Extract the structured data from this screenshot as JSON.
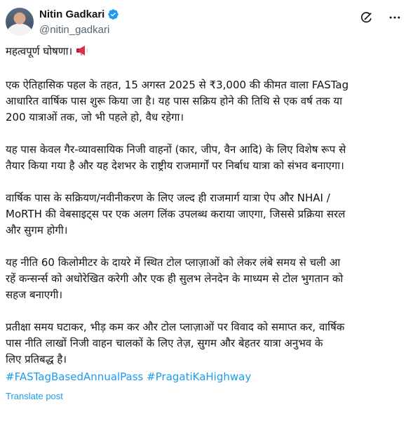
{
  "author": {
    "name": "Nitin Gadkari",
    "handle": "@nitin_gadkari",
    "verified": true,
    "verified_color": "#1d9bf0"
  },
  "header_icons": [
    "grok-icon",
    "more-options-icon"
  ],
  "post": {
    "paragraphs": [
      "महत्वपूर्ण घोषणा।",
      "एक ऐतिहासिक पहल के तहत, 15 अगस्त 2025 से ₹3,000 की कीमत वाला FASTag\nआधारित वार्षिक पास शुरू किया जा है। यह पास सक्रिय होने की तिथि से एक वर्ष तक या\n200 यात्राओं तक, जो भी पहले हो, वैध रहेगा।",
      "यह पास केवल गैर-व्यावसायिक निजी वाहनों (कार, जीप, वैन आदि) के लिए विशेष रूप से\nतैयार किया गया है और यह देशभर के राष्ट्रीय राजमार्गों पर निर्बाध यात्रा को संभव बनाएगा।",
      "वार्षिक पास के सक्रियण/नवीनीकरण के लिए जल्द ही राजमार्ग यात्रा ऐप और NHAI /\nMoRTH की वेबसाइट्स पर एक अलग लिंक उपलब्ध कराया जाएगा, जिससे प्रक्रिया सरल\nऔर सुगम होगी।",
      "यह नीति 60 किलोमीटर के दायरे में स्थित टोल प्लाज़ाओं को लेकर लंबे समय से चली आ\nरहें कन्सर्न्स को अधोरेखित करेगी और एक ही सुलभ लेनदेन के माध्यम से टोल भुगतान को\nसहज बनाएगी।",
      "प्रतीक्षा समय घटाकर, भीड़ कम कर और टोल प्लाज़ाओं पर विवाद को समाप्त कर, वार्षिक\nपास नीति लाखों निजी वाहन चालकों के लिए तेज़, सुगम और बेहतर यात्रा अनुभव के\nलिए प्रतिबद्ध है।"
    ],
    "hashtags": [
      "#FASTagBasedAnnualPass",
      "#PragatiKaHighway"
    ],
    "translate_label": "Translate post",
    "link_color": "#1d9bf0"
  }
}
